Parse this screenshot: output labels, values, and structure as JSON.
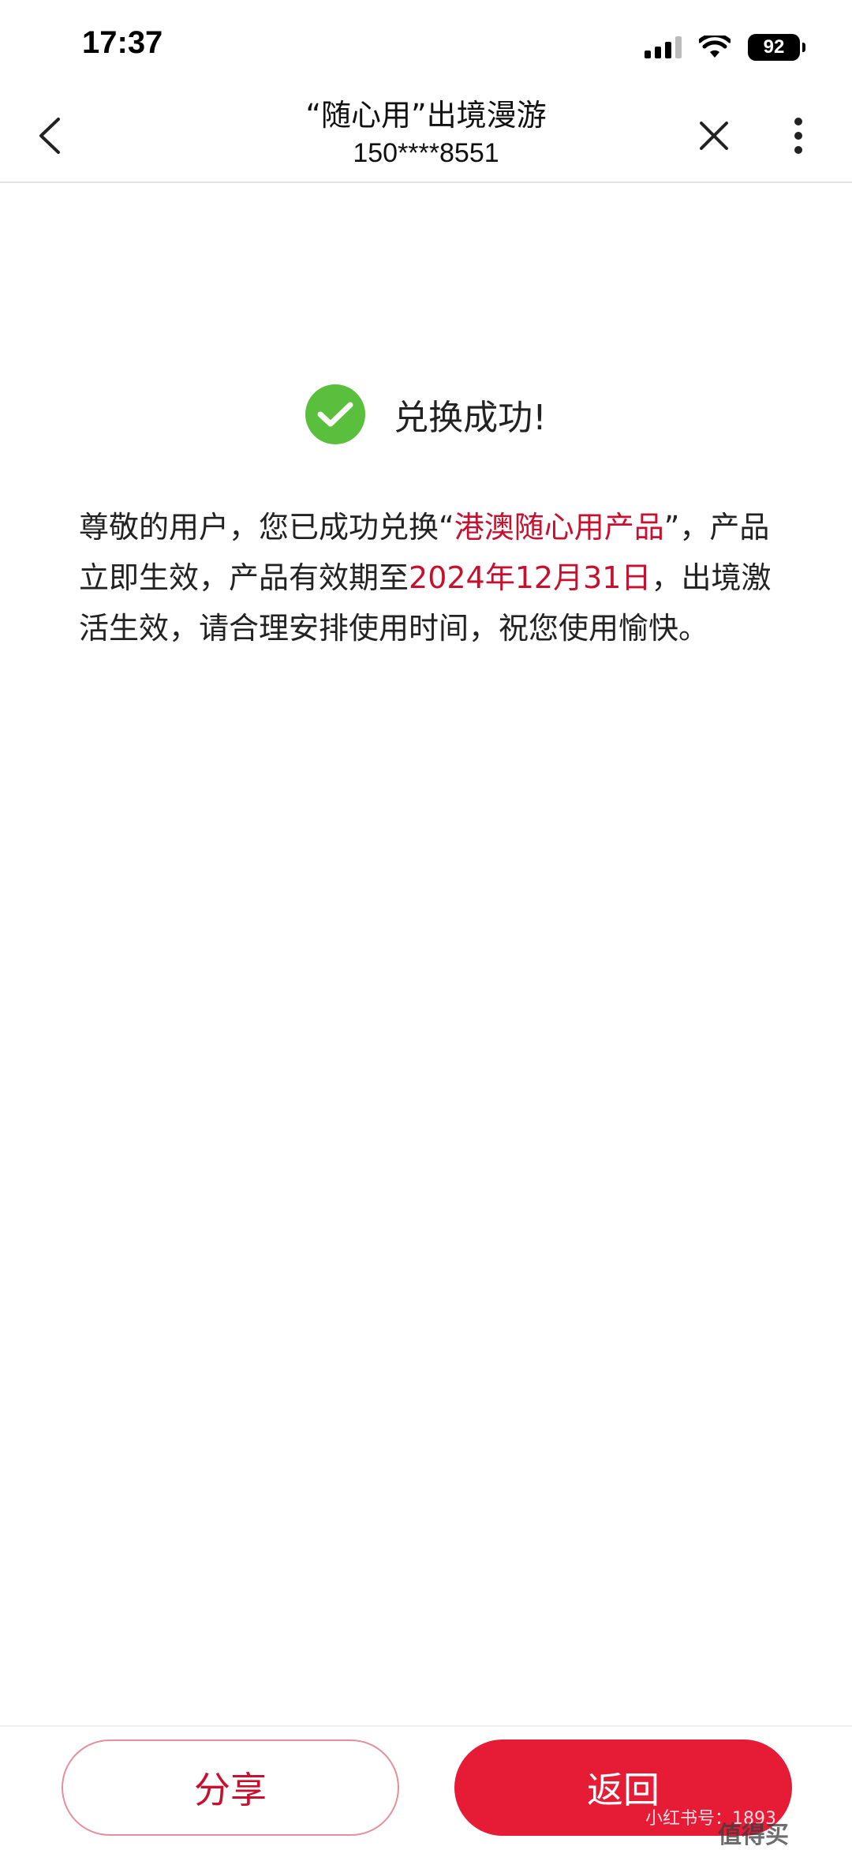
{
  "status_bar": {
    "time": "17:37",
    "battery": "92",
    "icons": [
      "signal-icon",
      "wifi-icon",
      "battery-icon"
    ]
  },
  "nav": {
    "title": "“随心用”出境漫游",
    "subtitle": "150****8551",
    "icons": [
      "back-icon",
      "close-icon",
      "more-icon"
    ]
  },
  "result": {
    "icon": "check-circle-icon",
    "icon_color": "#5bbf3e",
    "title": "兑换成功!"
  },
  "message": {
    "part1": "尊敬的用户，您已成功兑换“",
    "product": "港澳随心用产品",
    "part2": "”，产品立即生效，产品有效期至",
    "expiry": "2024年12月31日",
    "part3": "，出境激活生效，请合理安排使用时间，祝您使用愉快。"
  },
  "actions": {
    "share_label": "分享",
    "return_label": "返回"
  },
  "watermark": {
    "line": "小红书号：1893",
    "brand": "值得买"
  },
  "colors": {
    "accent": "#e61b35",
    "highlight": "#c8102e",
    "success": "#5bbf3e"
  }
}
